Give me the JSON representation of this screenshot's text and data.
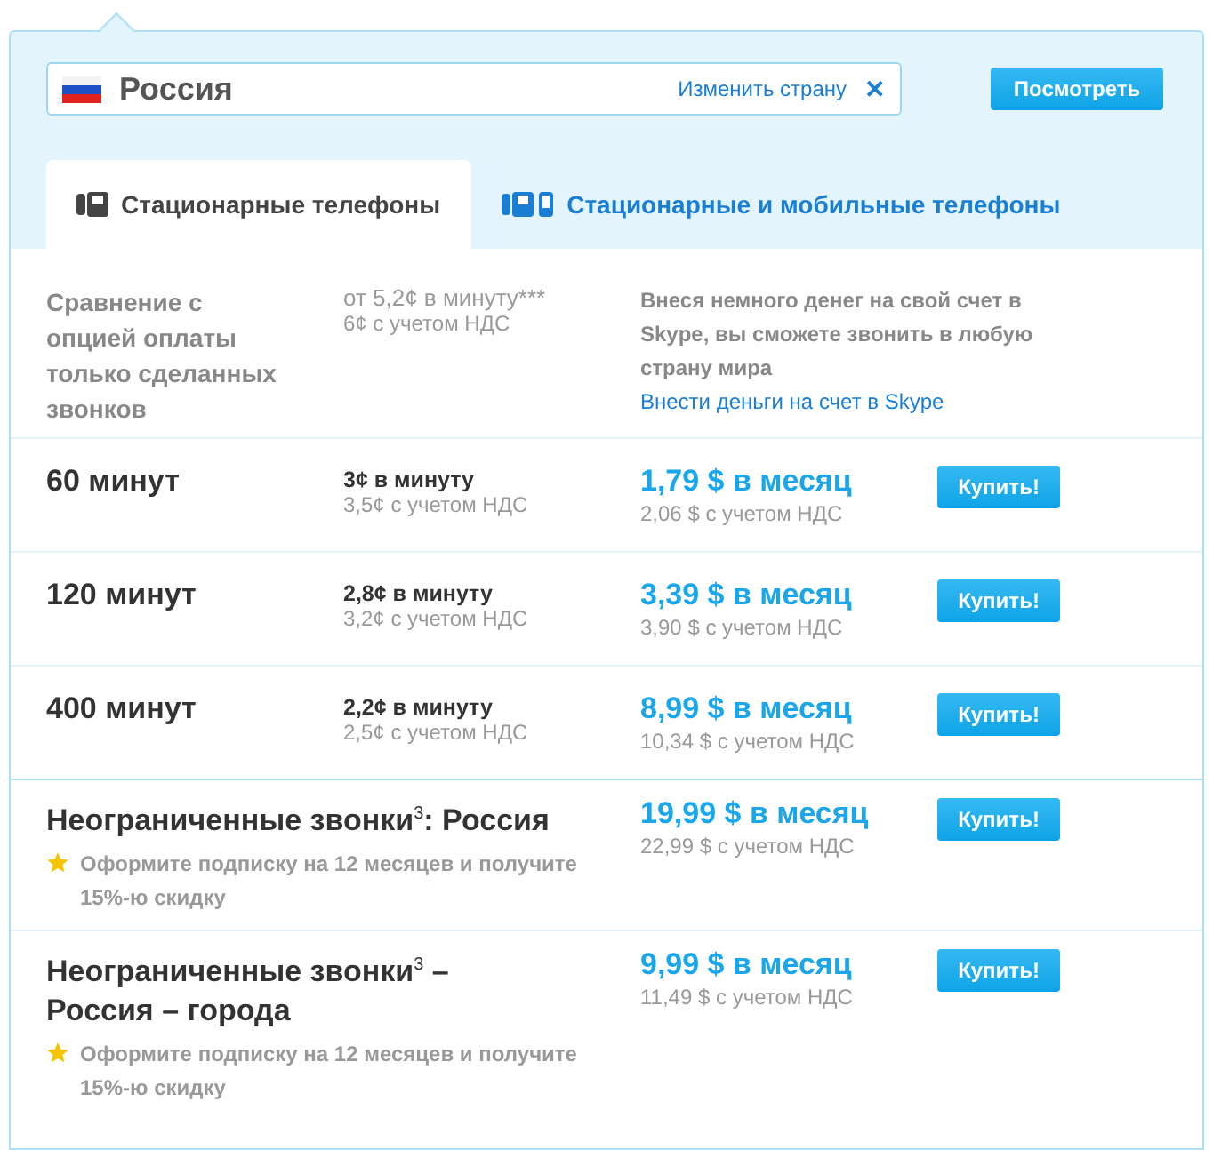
{
  "country": {
    "name": "Россия",
    "change_label": "Изменить страну",
    "clear": "✕"
  },
  "view_button": "Посмотреть",
  "tabs": [
    {
      "label": "Стационарные телефоны",
      "kind": "landline",
      "selected": true
    },
    {
      "label": "Стационарные и мобильные телефоны",
      "kind": "mobile",
      "selected": false
    }
  ],
  "comparison": {
    "label": "Сравнение с опцией оплаты только сделанных звонков",
    "rate": "от 5,2¢ в минуту***",
    "rate_vat": "6¢ с учетом НДС",
    "note": "Внеся немного денег на свой счет в Skype, вы сможете звонить в любую страну мира",
    "link": "Внести деньги на счет в Skype"
  },
  "plans": [
    {
      "kind": "minutes",
      "name": "60 минут",
      "rate": "3¢ в минуту",
      "rate_vat": "3,5¢ с учетом НДС",
      "price": "1,79 $ в месяц",
      "price_vat": "2,06 $ с учетом НДС",
      "button": "Купить!"
    },
    {
      "kind": "minutes",
      "name": "120 минут",
      "rate": "2,8¢ в минуту",
      "rate_vat": "3,2¢ с учетом НДС",
      "price": "3,39 $ в месяц",
      "price_vat": "3,90 $ с учетом НДС",
      "button": "Купить!"
    },
    {
      "kind": "minutes",
      "name": "400 минут",
      "rate": "2,2¢ в минуту",
      "rate_vat": "2,5¢ с учетом НДС",
      "price": "8,99 $ в месяц",
      "price_vat": "10,34 $ с учетом НДС",
      "button": "Купить!"
    },
    {
      "kind": "unlimited",
      "name": "Неограниченные звонки$^{3}$: Россия",
      "promo": "Оформите подписку на 12 месяцев и получите 15%-ю скидку",
      "price": "19,99 $ в месяц",
      "price_vat": "22,99 $ с учетом НДС",
      "button": "Купить!"
    },
    {
      "kind": "unlimited",
      "name": "Неограниченные звонки$^{3}$ – Россия – города",
      "promo": "Оформите подписку на 12 месяцев и получите 15%-ю скидку",
      "price": "9,99 $ в месяц",
      "price_vat": "11,49 $ с учетом НДС",
      "button": "Купить!"
    }
  ]
}
